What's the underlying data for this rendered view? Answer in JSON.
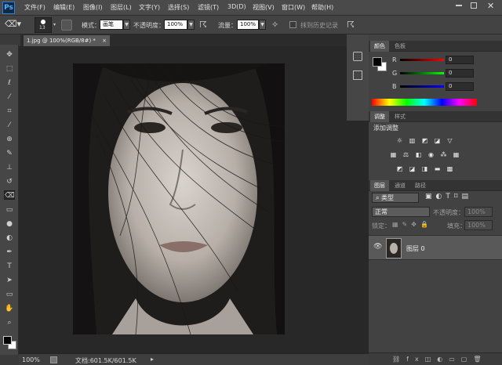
{
  "app": {
    "logo": "Ps",
    "colors": {
      "workspace": "#282828",
      "panel": "#424242",
      "accent": "#2f7fd6"
    }
  },
  "menu": [
    "文件(F)",
    "编辑(E)",
    "图像(I)",
    "图层(L)",
    "文字(Y)",
    "选择(S)",
    "滤镜(T)",
    "3D(D)",
    "视图(V)",
    "窗口(W)",
    "帮助(H)"
  ],
  "options": {
    "brush_size": "13",
    "mode_label": "模式：",
    "mode_value": "画笔",
    "opacity_label": "不透明度：",
    "opacity_value": "100%",
    "flow_label": "流量：",
    "flow_value": "100%",
    "history_label": "抹到历史记录"
  },
  "document": {
    "tab_title": "1.jpg @ 100%(RGB/8#) *",
    "close": "×"
  },
  "status": {
    "zoom": "100%",
    "doc_info": "文档:601.5K/601.5K"
  },
  "color_panel": {
    "tabs": [
      "颜色",
      "色板"
    ],
    "channels": [
      {
        "label": "R",
        "value": "0"
      },
      {
        "label": "G",
        "value": "0"
      },
      {
        "label": "B",
        "value": "0"
      }
    ]
  },
  "adjust_panel": {
    "tabs": [
      "调整",
      "样式"
    ],
    "title": "添加调整"
  },
  "layers_panel": {
    "tabs": [
      "图层",
      "通道",
      "路径"
    ],
    "filter_label": "类型",
    "blend_mode": "正常",
    "opacity_label": "不透明度：",
    "opacity_value": "100%",
    "lock_label": "锁定：",
    "fill_label": "填充：",
    "fill_value": "100%",
    "layers": [
      {
        "name": "图层 0",
        "visible": true
      }
    ]
  },
  "icons": [
    "move-icon",
    "marquee-icon",
    "lasso-icon",
    "quick-select-icon",
    "crop-icon",
    "eyedropper-icon",
    "healing-icon",
    "brush-icon",
    "stamp-icon",
    "history-brush-icon",
    "eraser-icon",
    "gradient-icon",
    "blur-icon",
    "dodge-icon",
    "pen-icon",
    "type-icon",
    "path-select-icon",
    "shape-icon",
    "hand-icon",
    "zoom-icon"
  ]
}
